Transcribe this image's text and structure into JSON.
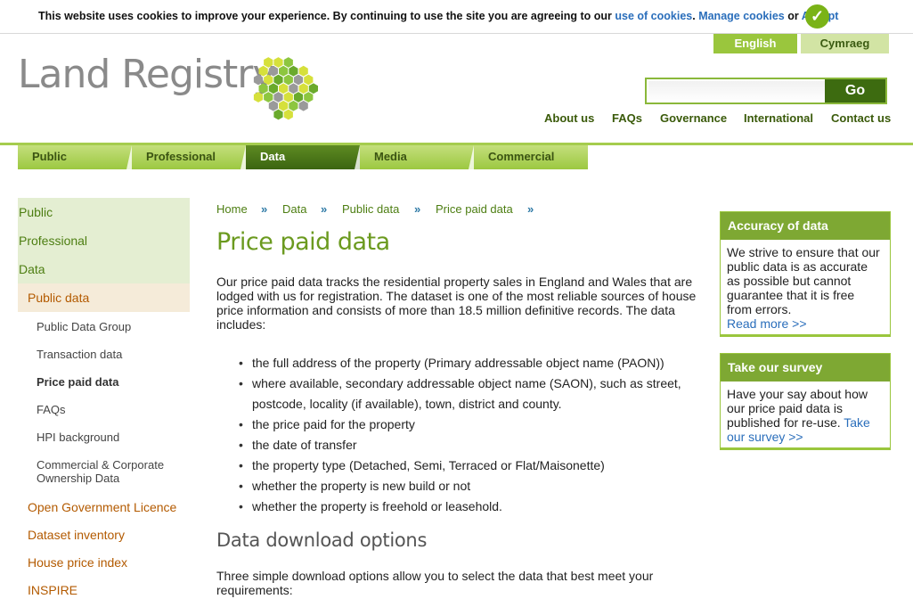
{
  "cookie": {
    "text": "This website uses cookies to improve your experience. By continuing to use the site you are agreeing to our ",
    "link_use": "use of cookies",
    "link_manage": "Manage cookies",
    "or": " or ",
    "accept": "Accept",
    "check_icon": "check-circle-icon"
  },
  "language": {
    "english": "English",
    "welsh": "Cymraeg"
  },
  "logo": {
    "text": "Land Registry",
    "colors": [
      "#8dc63f",
      "#d6e03b",
      "#9a9a9a",
      "#6aaa2c"
    ]
  },
  "search": {
    "placeholder": "",
    "button": "Go"
  },
  "toplinks": [
    "About us",
    "FAQs",
    "Governance",
    "International",
    "Contact us"
  ],
  "mainnav": [
    "Public",
    "Professional",
    "Data",
    "Media",
    "Commercial"
  ],
  "sidebar": {
    "top": [
      "Public",
      "Professional",
      "Data"
    ],
    "active": "Public data",
    "sub": [
      "Public Data Group",
      "Transaction data",
      "Price paid data",
      "FAQs",
      "HPI background"
    ],
    "sub_multi": [
      "Commercial & Corporate",
      "Ownership Data"
    ],
    "orange": [
      "Open Government Licence",
      "Dataset inventory",
      "House price index",
      "INSPIRE"
    ]
  },
  "breadcrumb": [
    "Home",
    "Data",
    "Public data",
    "Price paid data"
  ],
  "breadcrumb_sep": "»",
  "title": "Price paid data",
  "intro": "Our price paid data tracks the residential property sales in England and Wales that are lodged with us for registration. The dataset is one of the most reliable sources of house price information and consists of more than 18.5 million definitive records. The data includes:",
  "bullets": [
    "the full address of the property (Primary addressable object name (PAON))",
    "where available, secondary addressable object name (SAON), such as street, postcode, locality (if available), town, district and county.",
    "the price paid for the property",
    "the date of transfer",
    "the property type (Detached, Semi, Terraced or Flat/Maisonette)",
    "whether the property is new build or not",
    "whether the property is freehold or leasehold."
  ],
  "downloads": {
    "heading": "Data download options",
    "text": "Three simple download options allow you to select the data that best meet your requirements:"
  },
  "accuracy": {
    "heading": "Accuracy of data",
    "body": "We strive to ensure that our public data is as accurate as possible but cannot guarantee that it is free from errors.",
    "link": "Read more >>"
  },
  "survey": {
    "heading": "Take our survey",
    "body": "Have your say about how our price paid data is published for re-use. ",
    "link": "Take our survey >>"
  }
}
